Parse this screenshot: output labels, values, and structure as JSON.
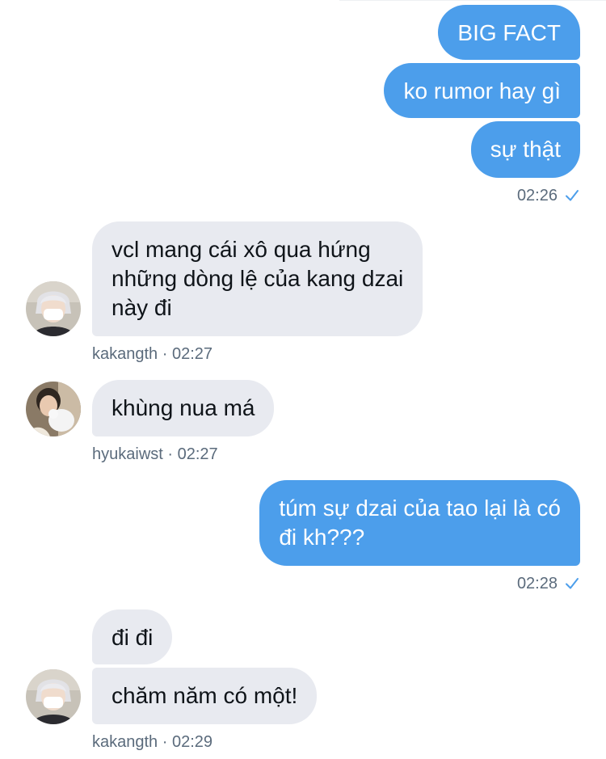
{
  "conversation": {
    "group1": {
      "messages": [
        "BIG FACT",
        "ko rumor hay gì",
        "sự thật"
      ],
      "time": "02:26"
    },
    "group2": {
      "message_line1": "vcl mang cái xô qua hứng",
      "message_line2": "những dòng lệ của kang dzai",
      "message_line3": "này đi",
      "username": "kakangth",
      "time": "02:27"
    },
    "group3": {
      "message": "khùng nua má",
      "username": "hyukaiwst",
      "time": "02:27"
    },
    "group4": {
      "message_line1": "túm sự dzai của tao lại là có",
      "message_line2": "đi kh???",
      "time": "02:28"
    },
    "group5": {
      "messages": [
        "đi đi",
        "chăm năm có một!"
      ],
      "username": "kakangth",
      "time": "02:29"
    },
    "separator": " · "
  },
  "icons": {
    "read_receipt": "check-icon",
    "avatar_kakangth": "avatar-masked-person",
    "avatar_hyukaiwst": "avatar-person-with-plush"
  },
  "colors": {
    "outgoing_bubble": "#4c9eeb",
    "incoming_bubble": "#e8eaf0",
    "meta_text": "#5b6b7c",
    "read_check": "#4c9eeb"
  }
}
